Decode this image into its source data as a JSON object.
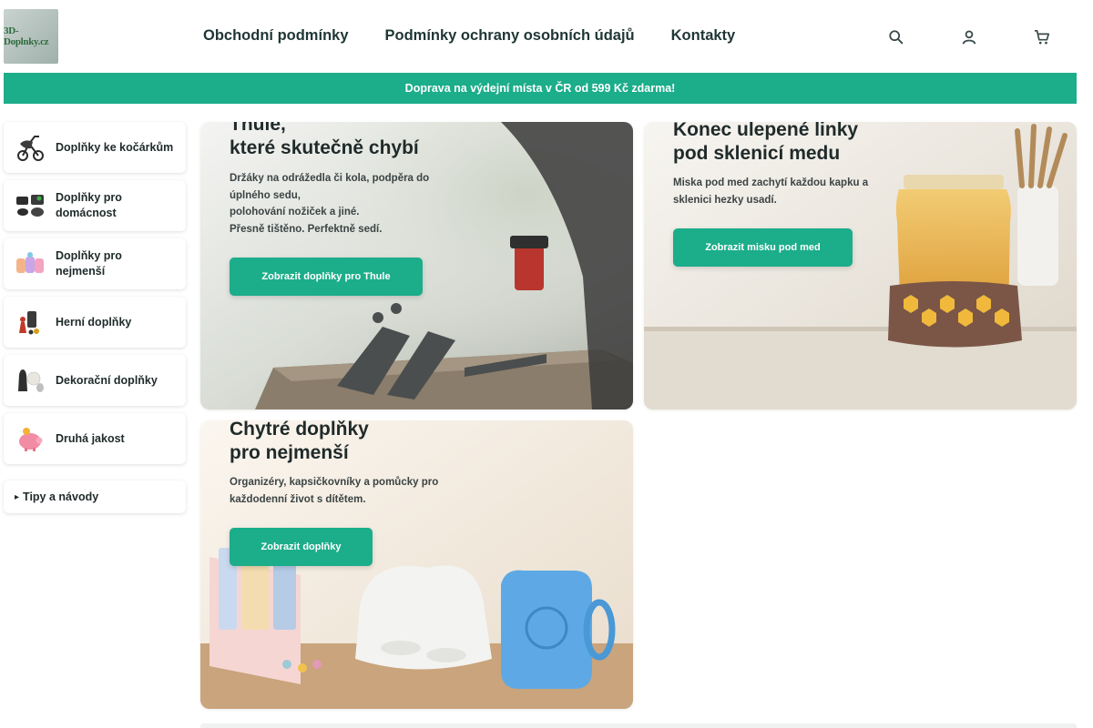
{
  "header": {
    "logo_text": "3D-Doplnky.cz",
    "nav": [
      {
        "label": "Obchodní podmínky"
      },
      {
        "label": "Podmínky ochrany osobních údajů"
      },
      {
        "label": "Kontakty"
      }
    ],
    "icons": [
      "search-icon",
      "user-icon",
      "cart-icon"
    ]
  },
  "banner": {
    "text": "Doprava na výdejní místa v ČR od 599 Kč zdarma!"
  },
  "sidebar": {
    "categories": [
      {
        "label": "Doplňky ke kočárkům",
        "icon": "stroller-icon"
      },
      {
        "label": "Doplňky pro domácnost",
        "icon": "home-items-icon"
      },
      {
        "label": "Doplňky pro nejmenší",
        "icon": "baby-items-icon"
      },
      {
        "label": "Herní doplňky",
        "icon": "game-pieces-icon"
      },
      {
        "label": "Dekorační doplňky",
        "icon": "decor-vases-icon"
      },
      {
        "label": "Druhá jakost",
        "icon": "piggy-bank-icon"
      }
    ],
    "tips": {
      "label": "Tipy a návody",
      "icon": "chevron-right-icon"
    }
  },
  "cards": [
    {
      "title_line1": "Thule,",
      "title_line2": "které skutečně chybí",
      "desc": [
        "Držáky na odrážedla či kola, podpěra do",
        "úplného sedu,",
        "polohování nožiček a jiné.",
        "Přesně tištěno. Perfektně sedí."
      ],
      "cta": "Zobrazit doplňky pro Thule"
    },
    {
      "title_line1": "Konec ulepené linky",
      "title_line2": "pod sklenicí medu",
      "desc": [
        "Miska pod med zachytí každou kapku a",
        "sklenici hezky usadí."
      ],
      "cta": "Zobrazit misku pod med"
    },
    {
      "title_line1": "Chytré doplňky",
      "title_line2": "pro nejmenší",
      "desc": [
        "Organizéry, kapsičkovníky a pomůcky pro",
        "každodenní život s dítětem."
      ],
      "cta": "Zobrazit doplňky"
    }
  ],
  "colors": {
    "accent": "#1cad8a",
    "text": "#1f2a2a"
  }
}
